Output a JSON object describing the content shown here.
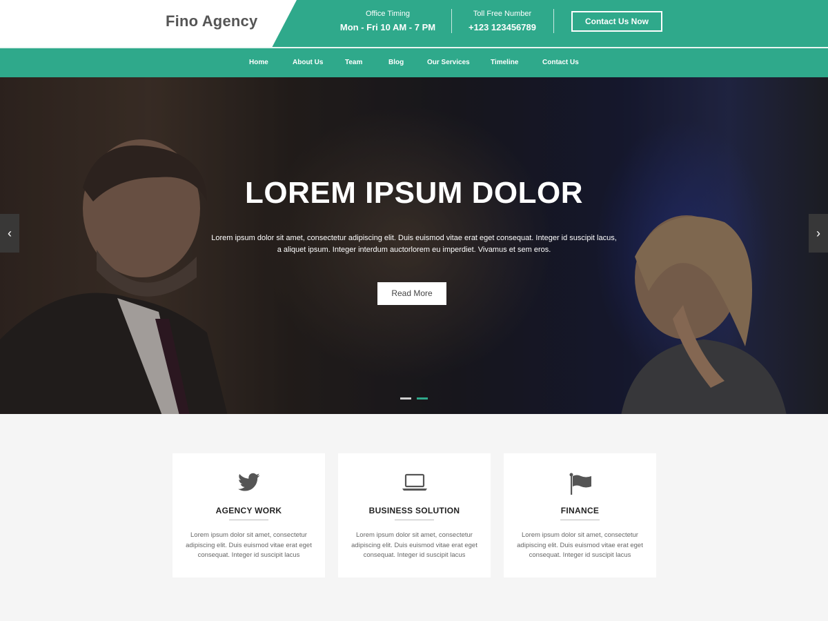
{
  "header": {
    "logo": "Fino Agency",
    "office_timing_label": "Office Timing",
    "office_timing_value": "Mon - Fri 10 AM - 7 PM",
    "toll_free_label": "Toll Free Number",
    "toll_free_value": "+123 123456789",
    "contact_button": "Contact Us Now"
  },
  "nav": {
    "items": [
      "Home",
      "About Us",
      "Team",
      "Blog",
      "Our Services",
      "Timeline",
      "Contact Us"
    ]
  },
  "hero": {
    "title": "LOREM IPSUM DOLOR",
    "text": "Lorem ipsum dolor sit amet, consectetur adipiscing elit. Duis euismod vitae erat eget consequat. Integer id suscipit lacus, a aliquet ipsum. Integer interdum auctorlorem eu imperdiet. Vivamus et sem eros.",
    "button": "Read More",
    "prev_icon": "chevron-left-icon",
    "next_icon": "chevron-right-icon"
  },
  "features": [
    {
      "icon": "twitter-icon",
      "title": "AGENCY WORK",
      "text": "Lorem ipsum dolor sit amet, consectetur adipiscing elit. Duis euismod vitae erat eget consequat. Integer id suscipit lacus"
    },
    {
      "icon": "laptop-icon",
      "title": "BUSINESS SOLUTION",
      "text": "Lorem ipsum dolor sit amet, consectetur adipiscing elit. Duis euismod vitae erat eget consequat. Integer id suscipit lacus"
    },
    {
      "icon": "flag-icon",
      "title": "FINANCE",
      "text": "Lorem ipsum dolor sit amet, consectetur adipiscing elit. Duis euismod vitae erat eget consequat. Integer id suscipit lacus"
    }
  ],
  "colors": {
    "accent": "#2fa98b",
    "background": "#f5f5f5"
  }
}
